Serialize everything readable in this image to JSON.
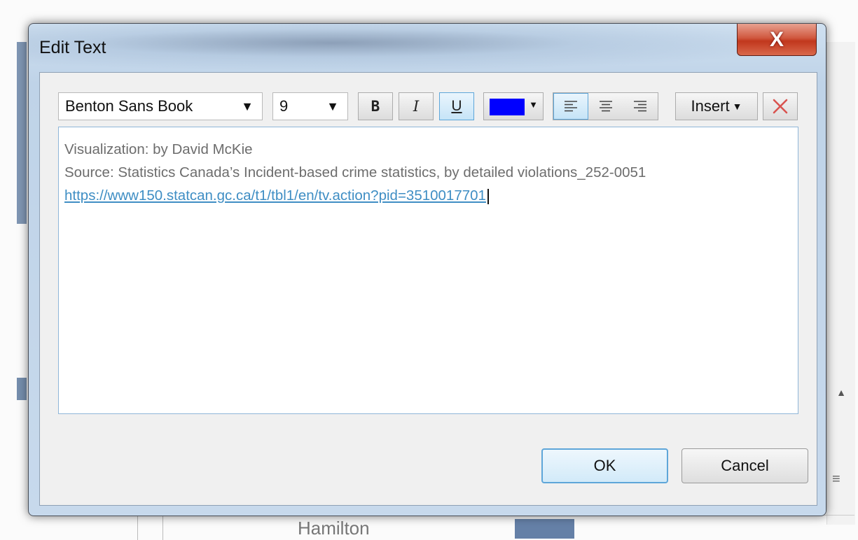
{
  "background": {
    "partial_label": "Hamilton"
  },
  "dialog": {
    "title": "Edit Text",
    "close_label": "X"
  },
  "toolbar": {
    "font_name": "Benton Sans Book",
    "font_size": "9",
    "bold_label": "B",
    "italic_label": "I",
    "underline_label": "U",
    "underline_active": true,
    "text_color": "#0000ff",
    "align_selected": "left",
    "insert_label": "Insert",
    "icons": [
      "dropdown-arrow-icon",
      "align-left-icon",
      "align-center-icon",
      "align-right-icon",
      "clear-x-icon"
    ]
  },
  "editor": {
    "lines": [
      "Visualization: by David McKie",
      "Source: Statistics Canada’s Incident-based crime statistics, by detailed violations_252-0051",
      "https://www150.statcan.gc.ca/t1/tbl1/en/tv.action?pid=3510017701"
    ]
  },
  "buttons": {
    "ok": "OK",
    "cancel": "Cancel"
  },
  "colors": {
    "link": "#3f8ec4",
    "close_red": "#c1371d",
    "focus_blue": "#5ea6d9"
  }
}
